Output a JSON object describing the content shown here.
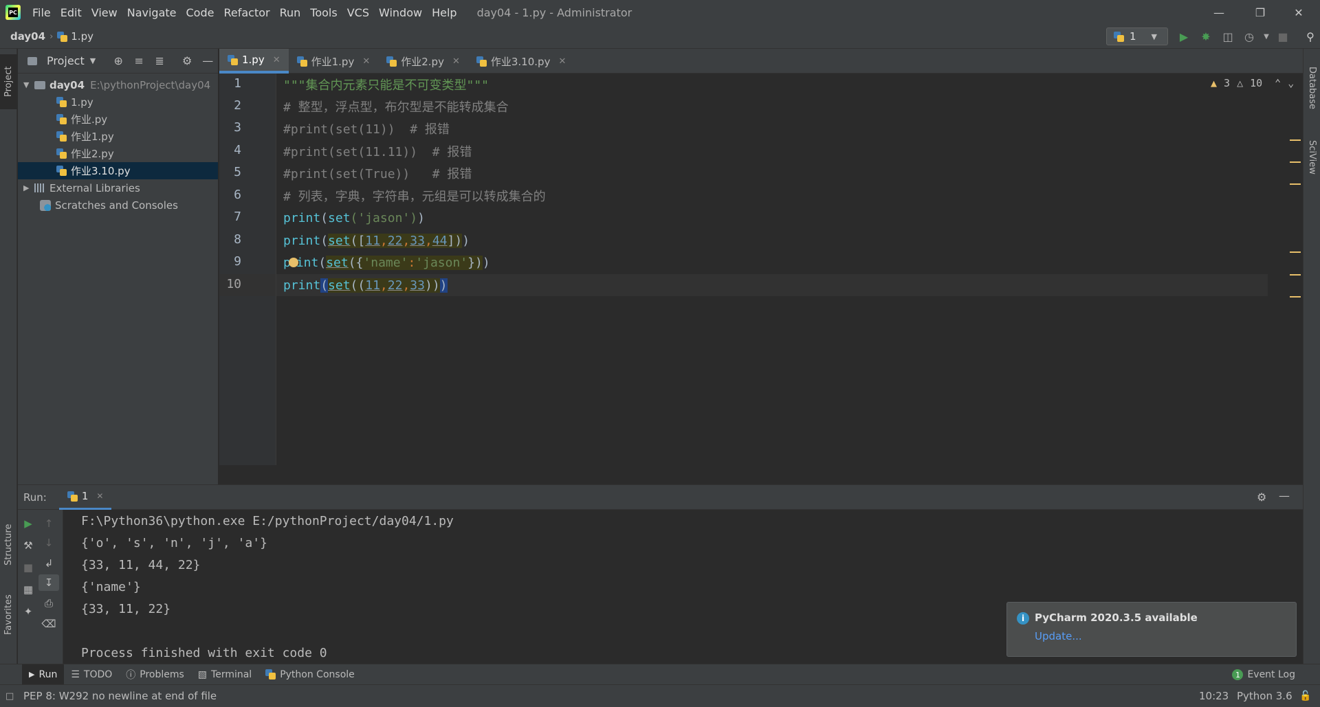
{
  "menu": [
    "File",
    "Edit",
    "View",
    "Navigate",
    "Code",
    "Refactor",
    "Run",
    "Tools",
    "VCS",
    "Window",
    "Help"
  ],
  "window_title": "day04 - 1.py - Administrator",
  "breadcrumb": {
    "project": "day04",
    "file": "1.py"
  },
  "run_config": {
    "label": "1"
  },
  "left_stripe": {
    "project": "Project",
    "structure": "Structure",
    "favorites": "Favorites"
  },
  "right_stripe": {
    "database": "Database",
    "sciview": "SciView"
  },
  "project_panel": {
    "title": "Project",
    "root": {
      "name": "day04",
      "path": "E:\\pythonProject\\day04"
    },
    "files": [
      "1.py",
      "作业.py",
      "作业1.py",
      "作业2.py",
      "作业3.10.py"
    ],
    "selected_file": "作业3.10.py",
    "external_libraries": "External Libraries",
    "scratches": "Scratches and Consoles"
  },
  "editor_tabs": [
    {
      "label": "1.py",
      "active": true
    },
    {
      "label": "作业1.py",
      "active": false
    },
    {
      "label": "作业2.py",
      "active": false
    },
    {
      "label": "作业3.10.py",
      "active": false
    }
  ],
  "inspection": {
    "warnings": "3",
    "weak_warnings": "10"
  },
  "code": {
    "line_numbers": [
      "1",
      "2",
      "3",
      "4",
      "5",
      "6",
      "7",
      "8",
      "9",
      "10"
    ],
    "l1": "\"\"\"集合内元素只能是不可变类型\"\"\"",
    "l2": "# 整型，浮点型，布尔型是不能转成集合",
    "l3": "#print(set(11))  # 报错",
    "l4": "#print(set(11.11))  # 报错",
    "l5": "#print(set(True))   # 报错",
    "l6": "# 列表，字典，字符串，元组是可以转成集合的",
    "l7": {
      "print": "print",
      "open": "(",
      "set": "set",
      "arg": "('jason')",
      "close": ")"
    },
    "l8": {
      "print": "print",
      "open": "(",
      "set": "set",
      "p1": "([",
      "n1": "11",
      "n2": "22",
      "n3": "33",
      "n4": "44",
      "p2": "])",
      "close": ")"
    },
    "l9": {
      "p": "p",
      "rest": "int",
      "open": "(",
      "set": "set",
      "p1": "({",
      "k": "'name'",
      "colon": ":",
      "v": "'jason'",
      "p2": "})",
      "close": ")"
    },
    "l10": {
      "print": "print",
      "open": "(",
      "set": "set",
      "p1": "((",
      "n1": "11",
      "n2": "22",
      "n3": "33",
      "p2": "))",
      "close": ")"
    }
  },
  "run_panel": {
    "label": "Run:",
    "tab": "1",
    "output": [
      "F:\\Python36\\python.exe E:/pythonProject/day04/1.py",
      "{'o', 's', 'n', 'j', 'a'}",
      "{33, 11, 44, 22}",
      "{'name'}",
      "{33, 11, 22}",
      "",
      "Process finished with exit code 0"
    ]
  },
  "notification": {
    "title": "PyCharm 2020.3.5 available",
    "link": "Update..."
  },
  "bottom_tools": [
    "Run",
    "TODO",
    "Problems",
    "Terminal",
    "Python Console"
  ],
  "event_log": "Event Log",
  "event_count": "1",
  "status": {
    "message": "PEP 8: W292 no newline at end of file",
    "position": "10:23",
    "interpreter": "Python 3.6"
  },
  "colors": {
    "accent": "#4a88c7",
    "warning": "#e8bf6a",
    "run_green": "#499c54",
    "link": "#589df6"
  }
}
